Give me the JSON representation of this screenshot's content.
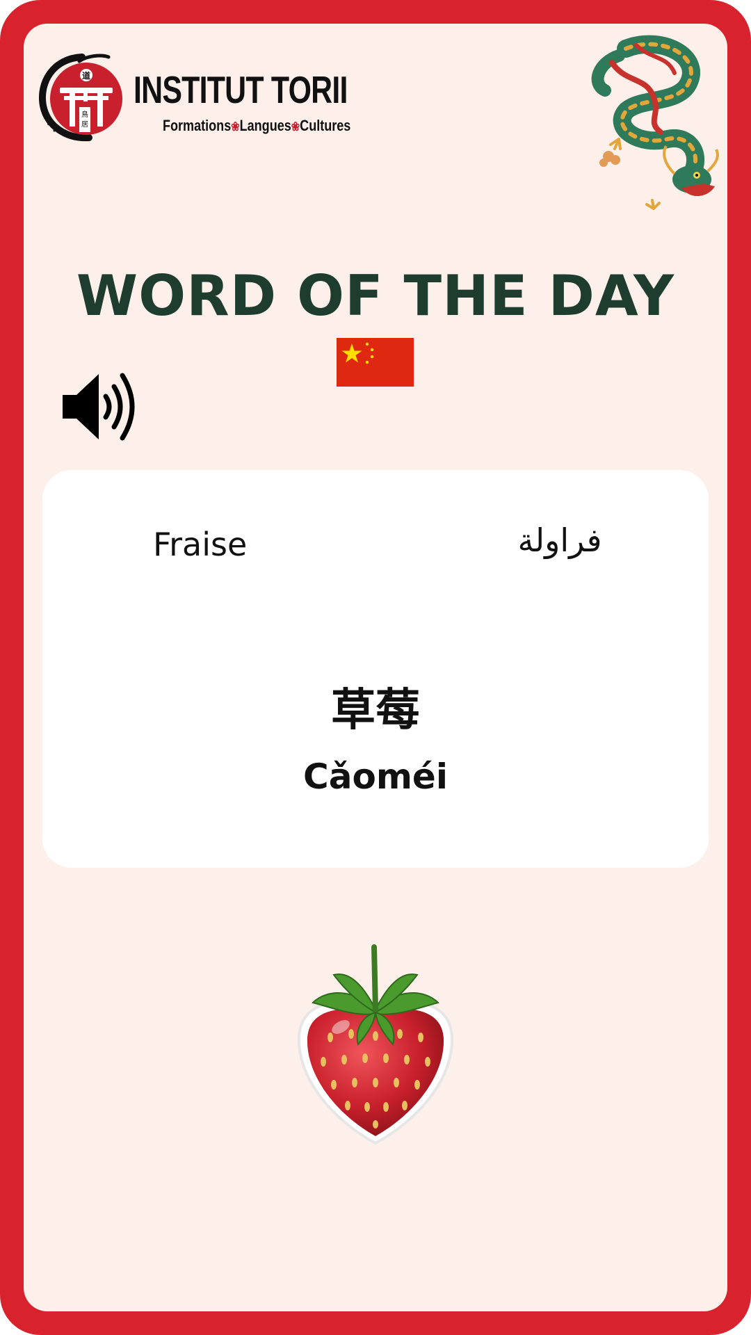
{
  "brand": {
    "name": "INSTITUT TORII",
    "tagline_parts": [
      "Formations",
      "Langues",
      "Cultures"
    ],
    "logo_characters": "道 鳥居"
  },
  "title": "WORD OF THE DAY",
  "language_flag": "china-flag",
  "audio_icon": "speaker-icon",
  "word": {
    "french": "Fraise",
    "arabic": "فراولة",
    "chinese": "草莓",
    "pinyin": "Cǎoméi"
  },
  "illustration": "strawberry-icon",
  "colors": {
    "frame": "#d8232e",
    "background": "#fdf0ea",
    "card": "#ffffff",
    "title": "#1f3d2e"
  }
}
